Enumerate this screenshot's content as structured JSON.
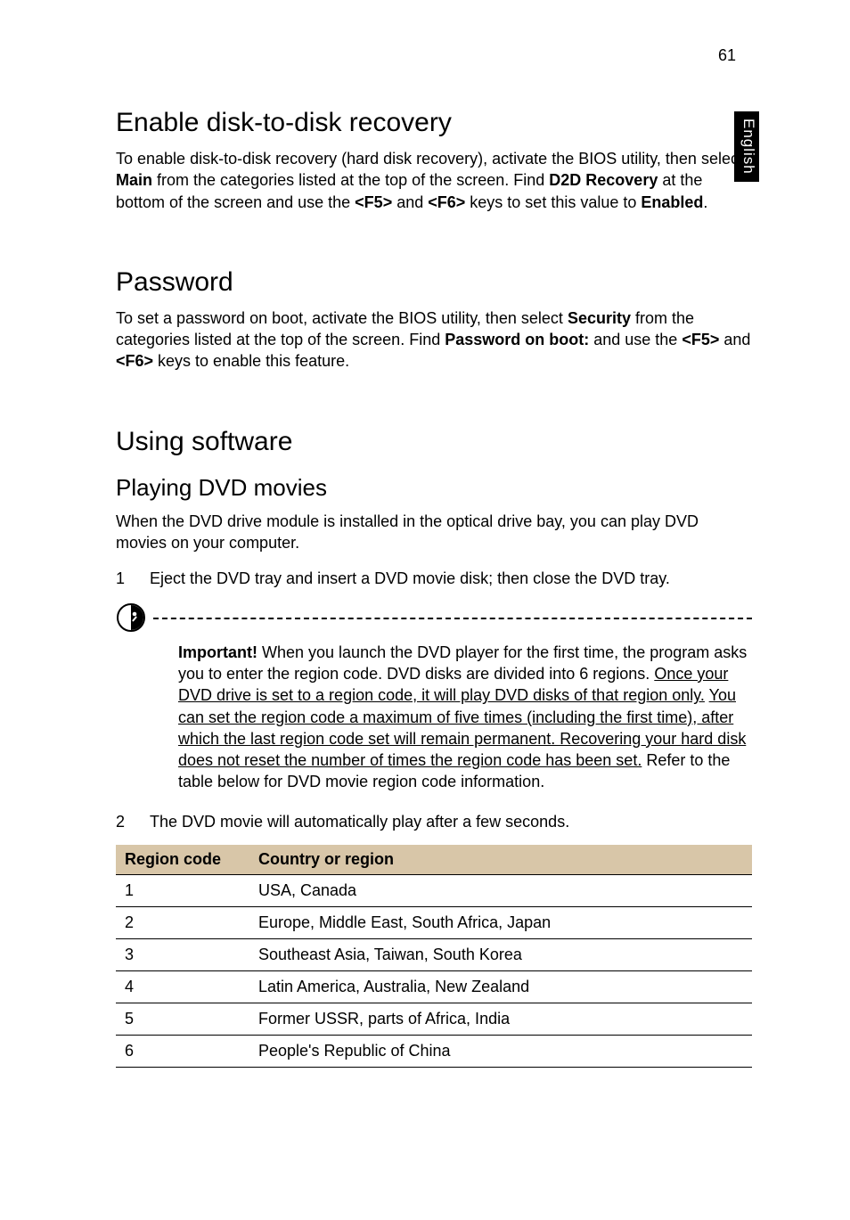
{
  "pageNumber": "61",
  "sideTab": "English",
  "h1_enable": "Enable disk-to-disk recovery",
  "p_enable_parts": {
    "a": "To enable disk-to-disk recovery (hard disk recovery), activate the BIOS utility, then select ",
    "main": "Main",
    "b": " from the categories listed at the top of the screen. Find ",
    "d2d": "D2D Recovery",
    "c": " at the bottom of the screen and use the ",
    "f5": "<F5>",
    "and1": " and ",
    "f6": "<F6>",
    "d": " keys to set this value to ",
    "enabled": "Enabled",
    "e": "."
  },
  "h1_password": "Password",
  "p_password_parts": {
    "a": "To set a password on boot, activate the BIOS utility, then select ",
    "security": "Security",
    "b": " from the categories listed at the top of the screen. Find ",
    "pob": "Password on boot:",
    "c": " and use the ",
    "f5": "<F5>",
    "and1": " and ",
    "f6": "<F6>",
    "d": " keys to enable this feature."
  },
  "h1_using": "Using software",
  "h2_playing": "Playing DVD movies",
  "p_playing": "When the DVD drive module is installed in the optical drive bay, you can play DVD movies on your computer.",
  "step1_num": "1",
  "step1_text": "Eject the DVD tray and insert a DVD movie disk; then close the DVD tray.",
  "note": {
    "important": "Important!",
    "a": " When you launch the DVD player for the first time, the program asks you to enter the region code. DVD disks are divided into 6 regions. ",
    "u1": "Once your DVD drive is set to a region code, it will play DVD disks of that region only.",
    "mid": " ",
    "u2": "You can set the region code a maximum of five times (including the first time), after which the last region code set will remain permanent. Recovering your hard disk does not reset the number of times the region code has been set.",
    "b": " Refer to the table below for DVD movie region code information."
  },
  "step2_num": "2",
  "step2_text": "The DVD movie will automatically play after a few seconds.",
  "table": {
    "head_code": "Region code",
    "head_country": "Country or region",
    "rows": [
      {
        "code": "1",
        "country": "USA, Canada"
      },
      {
        "code": "2",
        "country": "Europe, Middle East, South Africa, Japan"
      },
      {
        "code": "3",
        "country": "Southeast Asia, Taiwan, South Korea"
      },
      {
        "code": "4",
        "country": "Latin America, Australia, New Zealand"
      },
      {
        "code": "5",
        "country": "Former USSR, parts of Africa, India"
      },
      {
        "code": "6",
        "country": "People's Republic of China"
      }
    ]
  }
}
